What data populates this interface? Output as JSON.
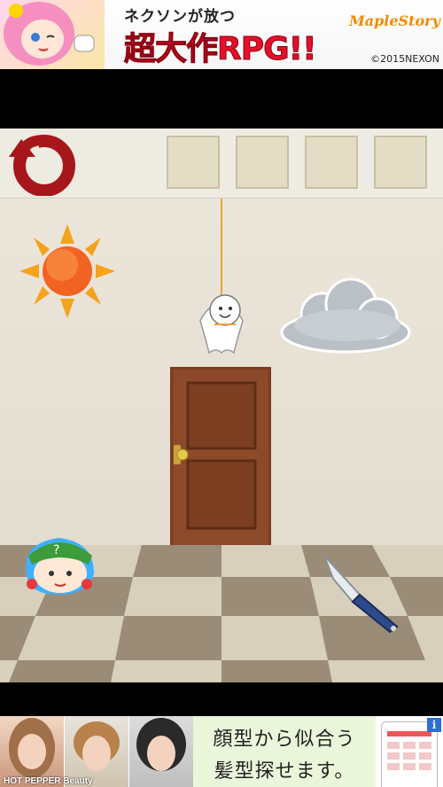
{
  "ad_top": {
    "tagline": "ネクソンが放つ",
    "headline": "超大作RPG!!",
    "brand": "MapleStory",
    "copyright": "©2015NEXON"
  },
  "toolbar": {
    "undo_icon": "rotate-arrow-icon",
    "inventory_slots": 4
  },
  "scene": {
    "items": [
      "sun",
      "teru-teru-bozu",
      "cloud",
      "door",
      "yukkuri-nitori",
      "knife"
    ]
  },
  "ad_bottom": {
    "brand": "HOT PEPPER Beauty",
    "line1": "顔型から似合う",
    "line2": "髪型探せます。",
    "info_label": "i"
  },
  "colors": {
    "wall": "#e8e2d7",
    "toolbar": "#eeebe2",
    "slot": "#e4ddc6",
    "undo": "#a6161a",
    "door": "#7a3c22",
    "floor_light": "#d8cfbc",
    "floor_dark": "#9a8c76"
  }
}
